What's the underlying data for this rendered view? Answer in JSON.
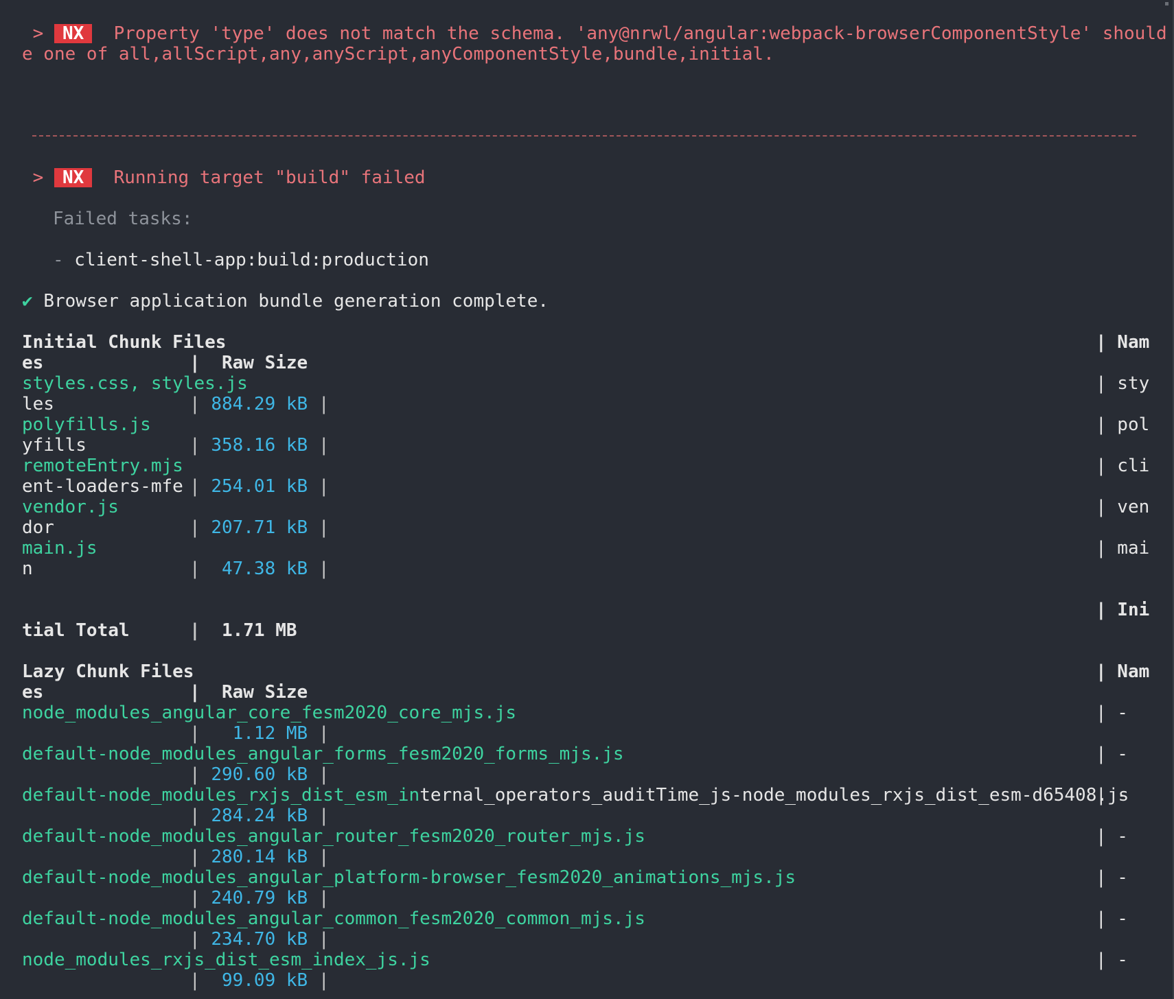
{
  "error": {
    "badge": "NX",
    "message_line1": "Property 'type' does not match the schema. 'any@nrwl/angular:webpack-browserComponentStyle' should b",
    "message_line2": "e one of all,allScript,any,anyScript,anyComponentStyle,bundle,initial."
  },
  "run": {
    "badge": "NX",
    "message": "Running target \"build\" failed",
    "failed_label": "Failed tasks:",
    "failed_task": "- client-shell-app:build:production"
  },
  "status": {
    "check": "✔",
    "text": "Browser application bundle generation complete."
  },
  "initial": {
    "header_left": "Initial Chunk Files",
    "header_right": "| Nam",
    "subheader_left": "es",
    "subheader_mid": "|  Raw Size",
    "rows": [
      {
        "file": "styles.css, styles.js",
        "right": "| sty",
        "name_rest": "les",
        "size": "884.29 kB"
      },
      {
        "file": "polyfills.js",
        "right": "| pol",
        "name_rest": "yfills",
        "size": "358.16 kB"
      },
      {
        "file": "remoteEntry.mjs",
        "right": "| cli",
        "name_rest": "ent-loaders-mfe",
        "size": "254.01 kB"
      },
      {
        "file": "vendor.js",
        "right": "| ven",
        "name_rest": "dor",
        "size": "207.71 kB"
      },
      {
        "file": "main.js",
        "right": "| mai",
        "name_rest": "n",
        "size": " 47.38 kB"
      }
    ],
    "total_right": "| Ini",
    "total_left": "tial Total",
    "total_value": "  1.71 MB"
  },
  "lazy": {
    "header_left": "Lazy Chunk Files",
    "header_right": "| Nam",
    "subheader_left": "es",
    "subheader_mid": "|  Raw Size",
    "rows": [
      {
        "file_green": "node_modules_angular_core_fesm2020_core_mjs.js",
        "file_white": "",
        "right": "| -",
        "size": "  1.12 MB"
      },
      {
        "file_green": "default-node_modules_angular_forms_fesm2020_forms_mjs.js",
        "file_white": "",
        "right": "| -",
        "size": "290.60 kB"
      },
      {
        "file_green": "default-node_modules_rxjs_dist_esm_in",
        "file_white": "ternal_operators_auditTime_js-node_modules_rxjs_dist_esm-d65408.js",
        "right": "| -",
        "size": "284.24 kB"
      },
      {
        "file_green": "default-node_modules_angular_router_fesm2020_router_mjs.js",
        "file_white": "",
        "right": "| -",
        "size": "280.14 kB"
      },
      {
        "file_green": "default-node_modules_angular_platform-browser_fesm2020_animations_mjs.js",
        "file_white": "",
        "right": "| -",
        "size": "240.79 kB"
      },
      {
        "file_green": "default-node_modules_angular_common_fesm2020_common_mjs.js",
        "file_white": "",
        "right": "| -",
        "size": "234.70 kB"
      },
      {
        "file_green": "node_modules_rxjs_dist_esm_index_js.js",
        "file_white": "",
        "right": "| -",
        "size": " 99.09 kB"
      }
    ]
  },
  "colors": {
    "background": "#282c34",
    "error_text": "#e8747a",
    "badge": "#e0393e",
    "file_green": "#3ed3a0",
    "size_cyan": "#3fb7e6"
  }
}
